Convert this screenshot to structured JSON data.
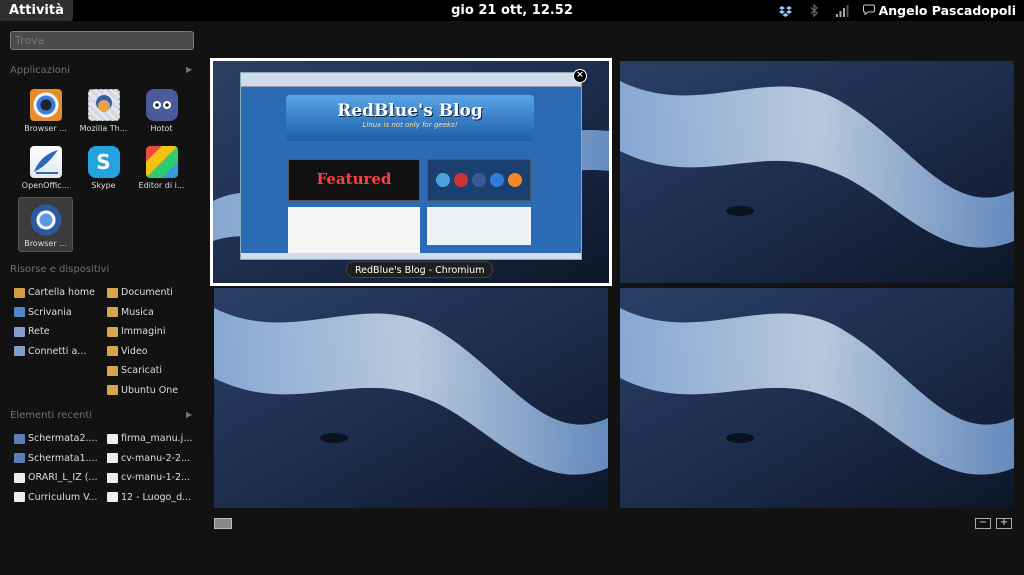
{
  "topbar": {
    "activities_label": "Attività",
    "clock": "gio 21 ott, 12.52",
    "user_name": "Angelo Pascadopoli",
    "tray_icons": [
      "dropbox-icon",
      "bluetooth-icon",
      "network-signal-icon",
      "user-status-icon"
    ]
  },
  "sidebar": {
    "search_placeholder": "Trova",
    "applications_title": "Applicazioni",
    "apps": [
      {
        "label": "Browser ...",
        "icon": "browser-eye-icon",
        "color": "#e38d2c"
      },
      {
        "label": "Mozilla Th...",
        "icon": "thunderbird-icon",
        "color": "#9fb4cf"
      },
      {
        "label": "Hotot",
        "icon": "hotot-icon",
        "color": "#4a5a9a"
      },
      {
        "label": "OpenOffic...",
        "icon": "openoffice-icon",
        "color": "#2e68b8"
      },
      {
        "label": "Skype",
        "icon": "skype-icon",
        "color": "#23a4e0"
      },
      {
        "label": "Editor di i...",
        "icon": "image-editor-icon",
        "color": "#c98a52"
      },
      {
        "label": "Browser ...",
        "icon": "chromium-icon",
        "color": "#4a7fc4"
      }
    ],
    "places_title": "Risorse e dispositivi",
    "places_left": [
      {
        "label": "Cartella home",
        "icon": "home-folder-icon"
      },
      {
        "label": "Scrivania",
        "icon": "desktop-icon"
      },
      {
        "label": "Rete",
        "icon": "network-icon"
      },
      {
        "label": "Connetti a...",
        "icon": "connect-server-icon"
      }
    ],
    "places_right": [
      {
        "label": "Documenti",
        "icon": "folder-icon"
      },
      {
        "label": "Musica",
        "icon": "folder-icon"
      },
      {
        "label": "Immagini",
        "icon": "folder-icon"
      },
      {
        "label": "Video",
        "icon": "folder-icon"
      },
      {
        "label": "Scaricati",
        "icon": "folder-icon"
      },
      {
        "label": "Ubuntu One",
        "icon": "folder-icon"
      }
    ],
    "recent_title": "Elementi recenti",
    "recent_left": [
      {
        "label": "Schermata2....",
        "icon": "screenshot-icon"
      },
      {
        "label": "Schermata1....",
        "icon": "screenshot-icon"
      },
      {
        "label": "ORARI_L_IZ (...",
        "icon": "document-icon"
      },
      {
        "label": "Curriculum V...",
        "icon": "document-icon"
      }
    ],
    "recent_right": [
      {
        "label": "firma_manu.j...",
        "icon": "image-file-icon"
      },
      {
        "label": "cv-manu-2-2...",
        "icon": "document-icon"
      },
      {
        "label": "cv-manu-1-2...",
        "icon": "document-icon"
      },
      {
        "label": "12 - Luogo_d...",
        "icon": "document-icon"
      }
    ]
  },
  "workspace": {
    "window_caption": "RedBlue's Blog - Chromium",
    "blog_title": "RedBlue's Blog",
    "blog_tagline": "Linux is not only for geeks!",
    "featured_label": "Featured",
    "close_label": "×",
    "zoom_out_label": "−",
    "zoom_in_label": "+"
  },
  "colors": {
    "panel": "#000000",
    "background": "#121212",
    "accent": "#ffffff"
  }
}
